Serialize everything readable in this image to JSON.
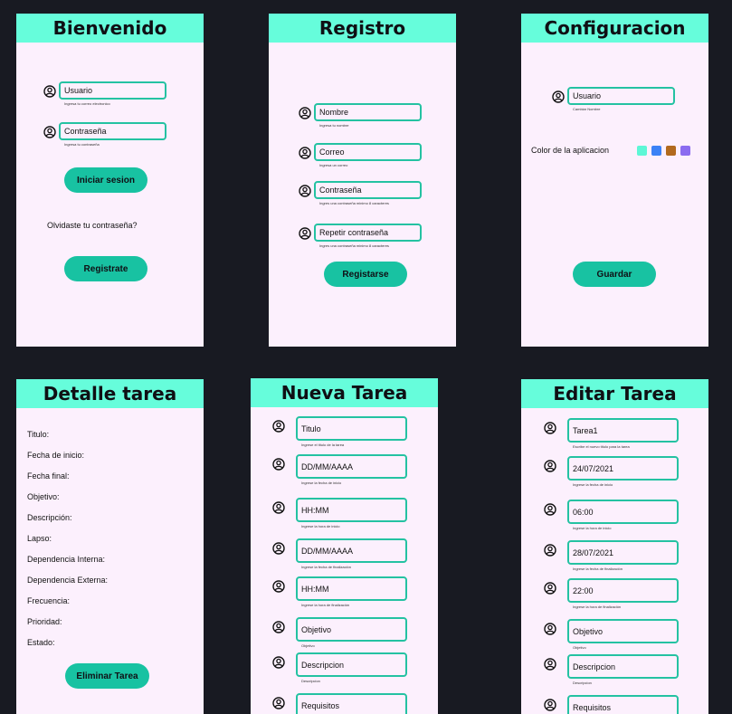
{
  "login": {
    "title": "Bienvenido",
    "user_placeholder": "Usuario",
    "user_hint": "Ingresa tu correo electronico",
    "pass_placeholder": "Contraseña",
    "pass_hint": "Ingresa tu contraseña",
    "login_button": "Iniciar sesion",
    "forgot": "Olvidaste tu contraseña?",
    "register_button": "Registrate"
  },
  "register": {
    "title": "Registro",
    "fields": [
      {
        "label": "Nombre",
        "hint": "Ingresa tu  nombre"
      },
      {
        "label": "Correo",
        "hint": "Ingresa un correo"
      },
      {
        "label": "Contraseña",
        "hint": "Ingres una contraseña minimo 8 caracteres"
      },
      {
        "label": "Repetir contraseña",
        "hint": "Ingres una contraseña minimo 8 caracteres"
      }
    ],
    "submit": "Registarse"
  },
  "config": {
    "title": "Configuracion",
    "user_placeholder": "Usuario",
    "user_hint": "Cambiar Nombre",
    "color_label": "Color de la aplicacion",
    "swatches": [
      "#5df7d6",
      "#3b82f6",
      "#b26a1e",
      "#8b6cf0"
    ],
    "save_button": "Guardar"
  },
  "detail": {
    "title": "Detalle tarea",
    "labels": [
      "Titulo:",
      "Fecha de inicio:",
      "Fecha final:",
      "Objetivo:",
      "Descripción:",
      "Lapso:",
      "Dependencia Interna:",
      "Dependencia Externa:",
      "Frecuencia:",
      "Prioridad:",
      "Estado:"
    ],
    "delete_button": "Eliminar Tarea"
  },
  "new_task": {
    "title": "Nueva Tarea",
    "fields": [
      {
        "value": "Titulo",
        "hint": "Ingrese el titulo de la tarea"
      },
      {
        "value": "DD/MM/AAAA",
        "hint": "Ingrese la fecha de inicio"
      },
      {
        "value": "HH:MM",
        "hint": "Ingrese la hora de inicio"
      },
      {
        "value": "DD/MM/AAAA",
        "hint": "Ingrese la fecha de finalización"
      },
      {
        "value": "HH:MM",
        "hint": "Ingrese la hora de finalización"
      },
      {
        "value": "Objetivo",
        "hint": "Objetivo"
      },
      {
        "value": "Descripcion",
        "hint": "Descripcion"
      },
      {
        "value": "Requisitos",
        "hint": ""
      }
    ]
  },
  "edit_task": {
    "title": "Editar Tarea",
    "fields": [
      {
        "value": "Tarea1",
        "hint": "Escribe el nuevo titulo para la tarea"
      },
      {
        "value": "24/07/2021",
        "hint": "Ingrese la fecha de inicio"
      },
      {
        "value": "06:00",
        "hint": "Ingrese la hora de inicio"
      },
      {
        "value": "28/07/2021",
        "hint": "Ingrese la fecha de finalización"
      },
      {
        "value": "22:00",
        "hint": "Ingrese la hora de finalización"
      },
      {
        "value": "Objetivo",
        "hint": "Objetivo"
      },
      {
        "value": "Descripcion",
        "hint": "Descripcion"
      },
      {
        "value": "Requisitos",
        "hint": ""
      }
    ]
  }
}
